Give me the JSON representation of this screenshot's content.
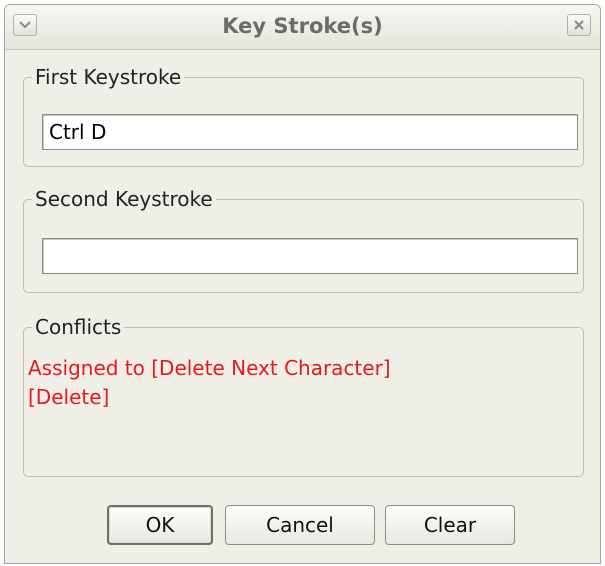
{
  "window": {
    "title": "Key Stroke(s)",
    "menu_icon": "chevron-down-icon",
    "close_icon": "close-icon"
  },
  "first_keystroke": {
    "legend": "First Keystroke",
    "value": "Ctrl D"
  },
  "second_keystroke": {
    "legend": "Second Keystroke",
    "value": ""
  },
  "conflicts": {
    "legend": "Conflicts",
    "lines": [
      "Assigned to [Delete Next Character]",
      "[Delete]"
    ],
    "color": "#e8181e"
  },
  "buttons": {
    "ok": "OK",
    "cancel": "Cancel",
    "clear": "Clear"
  }
}
